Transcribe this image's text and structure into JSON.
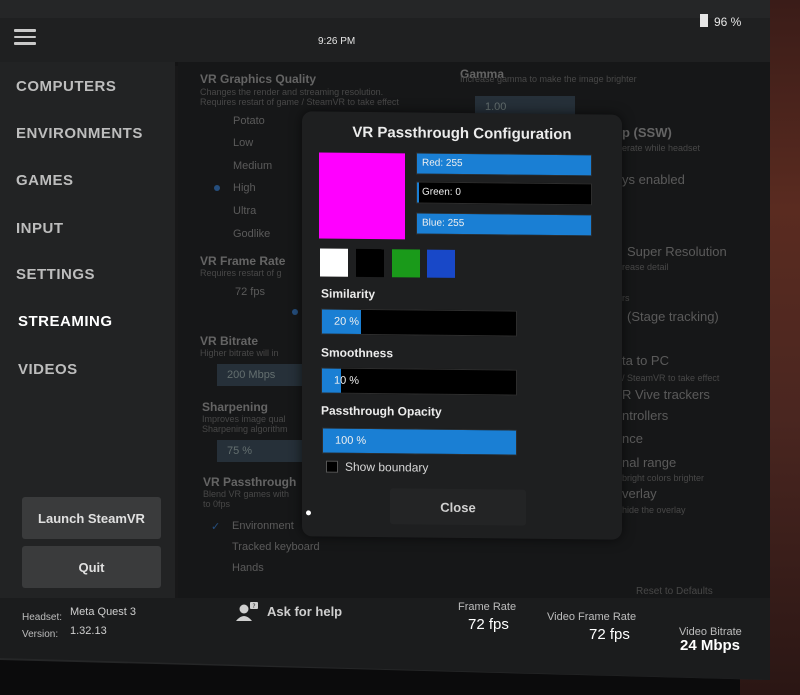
{
  "topbar": {
    "time": "9:26 PM",
    "battery": "96 %"
  },
  "sidebar": {
    "items": [
      "COMPUTERS",
      "ENVIRONMENTS",
      "GAMES",
      "INPUT",
      "SETTINGS",
      "STREAMING",
      "VIDEOS"
    ],
    "active": "STREAMING",
    "launch_button": "Launch SteamVR",
    "quit_button": "Quit"
  },
  "settings": {
    "graphics_title": "VR Graphics Quality",
    "graphics_desc1": "Changes the render and streaming resolution.",
    "graphics_desc2": "Requires restart of game / SteamVR to take effect",
    "quality_options": [
      "Potato",
      "Low",
      "Medium",
      "High",
      "Ultra",
      "Godlike"
    ],
    "frame_rate_title": "VR Frame Rate",
    "frame_rate_desc": "Requires restart of g",
    "frame_rate_value": "72 fps",
    "bitrate_title": "VR Bitrate",
    "bitrate_desc": "Higher bitrate will in",
    "bitrate_value": "200 Mbps",
    "sharpening_title": "Sharpening",
    "sharpening_desc1": "Improves image qual",
    "sharpening_desc2": "Sharpening algorithm",
    "sharpening_value": "75 %",
    "passthrough_title": "VR Passthrough",
    "passthrough_desc1": "Blend VR games with",
    "passthrough_desc2": "to 0fps",
    "passthrough_options": [
      "Environment",
      "Tracked keyboard",
      "Hands"
    ],
    "gamma_title": "Gamma",
    "gamma_desc": "Increase gamma to make the image brighter",
    "gamma_value": "1.00",
    "right_items": [
      "p (SSW)",
      "erate while headset",
      "ys enabled",
      "Super Resolution",
      "rease detail",
      "rs",
      "(Stage tracking)",
      "ta to PC",
      "/ SteamVR to take effect",
      "R Vive trackers",
      "ntrollers",
      "nce",
      "nal range",
      "bright colors brighter",
      "verlay",
      "hide the overlay"
    ],
    "reset_label": "Reset to Defaults"
  },
  "footer": {
    "headset_label": "Headset:",
    "headset_value": "Meta Quest 3",
    "version_label": "Version:",
    "version_value": "1.32.13",
    "help_label": "Ask for help",
    "frame_rate_label": "Frame Rate",
    "frame_rate_value": "72 fps",
    "video_frame_rate_label": "Video Frame Rate",
    "video_frame_rate_value": "72 fps",
    "video_bitrate_label": "Video Bitrate",
    "video_bitrate_value": "24 Mbps"
  },
  "modal": {
    "title": "VR Passthrough Configuration",
    "preview_color": "#ff00ff",
    "red_label": "Red: 255",
    "green_label": "Green: 0",
    "blue_label": "Blue: 255",
    "red_value": 255,
    "green_value": 0,
    "blue_value": 255,
    "presets": [
      "#ffffff",
      "#000000",
      "#1a9a1a",
      "#1848c8"
    ],
    "similarity_label": "Similarity",
    "similarity_value": "20 %",
    "similarity_fraction": 0.2,
    "smoothness_label": "Smoothness",
    "smoothness_value": "10 %",
    "smoothness_fraction": 0.1,
    "opacity_label": "Passthrough Opacity",
    "opacity_value": "100 %",
    "opacity_fraction": 1.0,
    "show_boundary_label": "Show boundary",
    "show_boundary_checked": false,
    "close_label": "Close"
  }
}
